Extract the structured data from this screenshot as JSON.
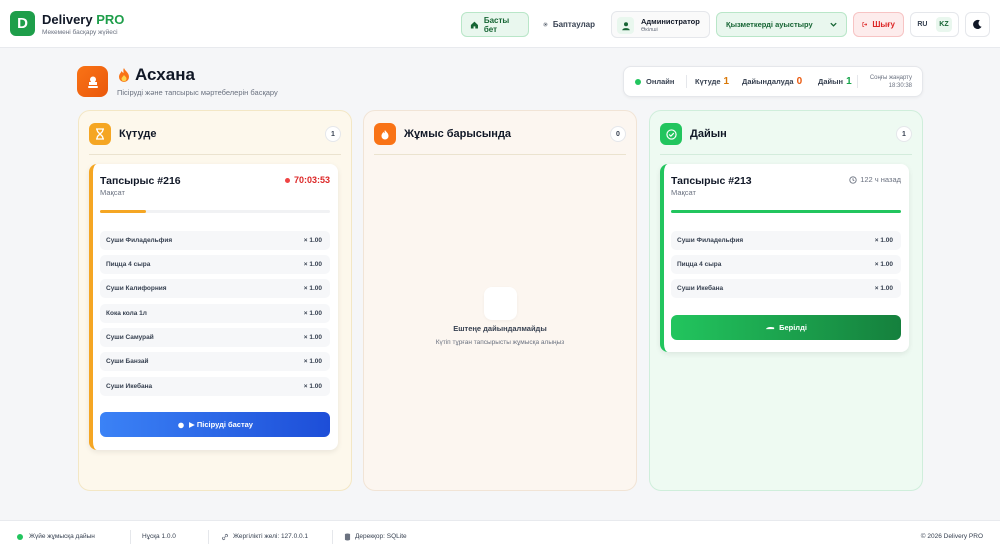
{
  "header": {
    "logo_letter": "D",
    "brand_name": "Delivery",
    "brand_suffix": "PRO",
    "brand_subtitle": "Мекемені басқару жүйесі",
    "home_label": "Басты бет",
    "settings_label": "Баптаулар",
    "user_name": "Администратор",
    "user_role": "Өкілші",
    "staff_switch_label": "Қызметкерді ауыстыру",
    "logout_label": "Шығу",
    "lang_ru": "RU",
    "lang_kz": "KZ"
  },
  "page": {
    "title": "Асхана",
    "subtitle": "Пісіруді және тапсырыс мәртебелерін басқару"
  },
  "status": {
    "online_label": "Онлайн",
    "waiting_label": "Күтуде",
    "waiting_count": "1",
    "cooking_label": "Дайындалуда",
    "cooking_count": "0",
    "ready_label": "Дайын",
    "ready_count": "1",
    "updated_label": "Соңғы жаңарту",
    "updated_time": "18:30:38"
  },
  "columns": {
    "waiting": {
      "title": "Күтуде",
      "count": "1"
    },
    "in_progress": {
      "title": "Жұмыс барысында",
      "count": "0",
      "empty_title": "Ештеңе дайындалмайды",
      "empty_subtitle": "Күтіп тұрған тапсырысты жұмысқа алыңыз"
    },
    "ready": {
      "title": "Дайын",
      "count": "1"
    }
  },
  "orders": {
    "waiting": {
      "name": "Тапсырыс #216",
      "type": "Мақсат",
      "timer": "70:03:53",
      "progress": 0.2,
      "items": [
        {
          "name": "Суши Филадельфия",
          "qty": "× 1.00"
        },
        {
          "name": "Пицца 4 сыра",
          "qty": "× 1.00"
        },
        {
          "name": "Суши Калифорния",
          "qty": "× 1.00"
        },
        {
          "name": "Кока кола 1л",
          "qty": "× 1.00"
        },
        {
          "name": "Суши Самурай",
          "qty": "× 1.00"
        },
        {
          "name": "Суши Банзай",
          "qty": "× 1.00"
        },
        {
          "name": "Суши Икебана",
          "qty": "× 1.00"
        }
      ],
      "action_label": "▶ Пісіруді бастау"
    },
    "ready": {
      "name": "Тапсырыс #213",
      "type": "Мақсат",
      "ago": "122 ч назад",
      "progress": 1.0,
      "items": [
        {
          "name": "Суши Филадельфия",
          "qty": "× 1.00"
        },
        {
          "name": "Пицца 4 сыра",
          "qty": "× 1.00"
        },
        {
          "name": "Суши Икебана",
          "qty": "× 1.00"
        }
      ],
      "action_label": "Берілді"
    }
  },
  "footer": {
    "system_status": "Жүйе жұмысқа дайын",
    "version": "Нұсқа 1.0.0",
    "network": "Жергілікті желі: 127.0.0.1",
    "database": "Дерекқор: SQLite",
    "copyright": "© 2026 Delivery PRO"
  },
  "colors": {
    "brand": "#1e9e4a",
    "waiting_accent": "#f5a623",
    "progress_accent": "#f97316",
    "ready_accent": "#22c55e",
    "start_button": "#2563eb",
    "danger": "#dc2626"
  },
  "icons": {
    "home": "home-icon",
    "settings": "gear-icon",
    "user": "user-icon",
    "logout": "logout-icon",
    "theme": "moon-icon",
    "kitchen": "kitchen-icon",
    "fire": "fire-icon",
    "waiting": "hourglass-icon",
    "in_progress": "flame-icon",
    "ready": "check-icon"
  }
}
